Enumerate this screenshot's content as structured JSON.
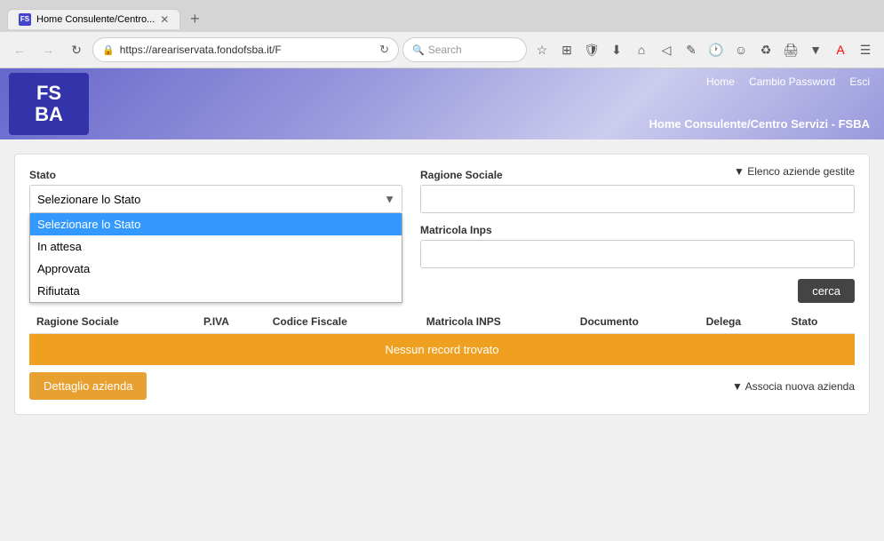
{
  "browser": {
    "tab_title": "Home Consulente/Centro...",
    "tab_favicon": "FS",
    "address_url": "https://areariservata.fondofsba.it/F",
    "search_placeholder": "Search",
    "new_tab_label": "+"
  },
  "header": {
    "logo_line1": "FS",
    "logo_line2": "BA",
    "nav_home": "Home",
    "nav_cambio_password": "Cambio Password",
    "nav_esci": "Esci",
    "subtitle": "Home Consulente/Centro Servizi - FSBA"
  },
  "elenco_link": "▼ Elenco aziende gestite",
  "form": {
    "stato_label": "Stato",
    "stato_placeholder": "Selezionare lo Stato",
    "ragione_sociale_label": "Ragione Sociale",
    "matricola_inps_label": "Matricola Inps",
    "dropdown_options": [
      {
        "value": "selezionare",
        "label": "Selezionare lo Stato",
        "selected": true
      },
      {
        "value": "in_attesa",
        "label": "In attesa",
        "selected": false
      },
      {
        "value": "approvata",
        "label": "Approvata",
        "selected": false
      },
      {
        "value": "rifiutata",
        "label": "Rifiutata",
        "selected": false
      }
    ],
    "cerca_label": "cerca"
  },
  "table": {
    "columns": [
      "Ragione Sociale",
      "P.IVA",
      "Codice Fiscale",
      "Matricola INPS",
      "Documento",
      "Delega",
      "Stato"
    ],
    "no_records_message": "Nessun record trovato"
  },
  "actions": {
    "dettaglio_label": "Dettaglio azienda",
    "associa_label": "▼ Associa nuova azienda"
  }
}
